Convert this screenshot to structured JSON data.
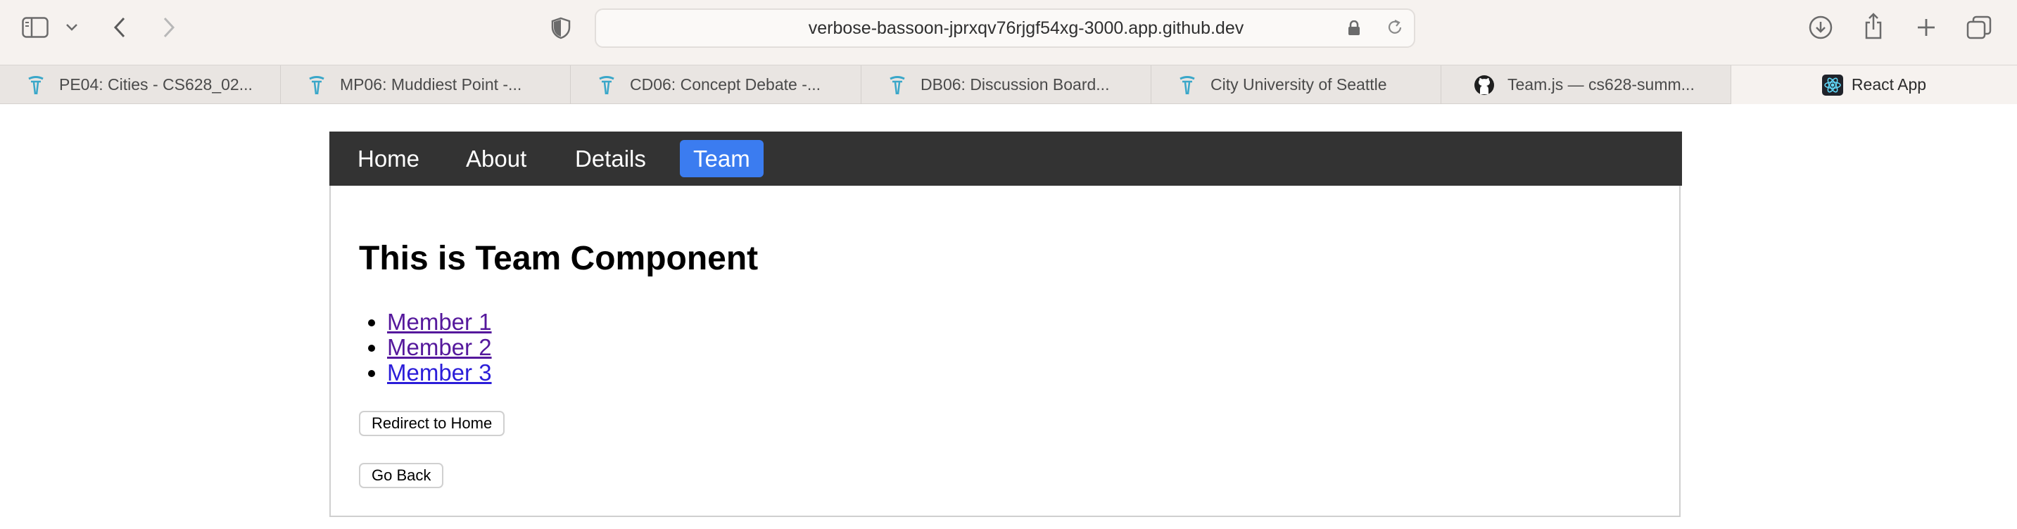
{
  "browser": {
    "url": "verbose-bassoon-jprxqv76rjgf54xg-3000.app.github.dev",
    "icons": [
      "sidebar-icon",
      "chevron-down-icon",
      "back-icon",
      "forward-icon",
      "shield-icon",
      "lock-icon",
      "reload-icon",
      "download-icon",
      "share-icon",
      "new-tab-icon",
      "tab-overview-icon"
    ]
  },
  "tabs": [
    {
      "label": "PE04: Cities - CS628_02...",
      "icon": "seattle-needle-icon"
    },
    {
      "label": "MP06: Muddiest Point -...",
      "icon": "seattle-needle-icon"
    },
    {
      "label": "CD06: Concept Debate -...",
      "icon": "seattle-needle-icon"
    },
    {
      "label": "DB06: Discussion Board...",
      "icon": "seattle-needle-icon"
    },
    {
      "label": "City University of Seattle",
      "icon": "seattle-needle-icon"
    },
    {
      "label": "Team.js — cs628-summ...",
      "icon": "github-icon"
    },
    {
      "label": "React App",
      "icon": "react-icon"
    }
  ],
  "nav": {
    "items": [
      "Home",
      "About",
      "Details",
      "Team"
    ],
    "active": "Team",
    "active_color": "#3b7cf0",
    "bar_color": "#333333"
  },
  "main": {
    "heading": "This is Team Component",
    "members": [
      "Member 1",
      "Member 2",
      "Member 3"
    ],
    "redirect_button": "Redirect to Home",
    "back_button": "Go Back"
  }
}
